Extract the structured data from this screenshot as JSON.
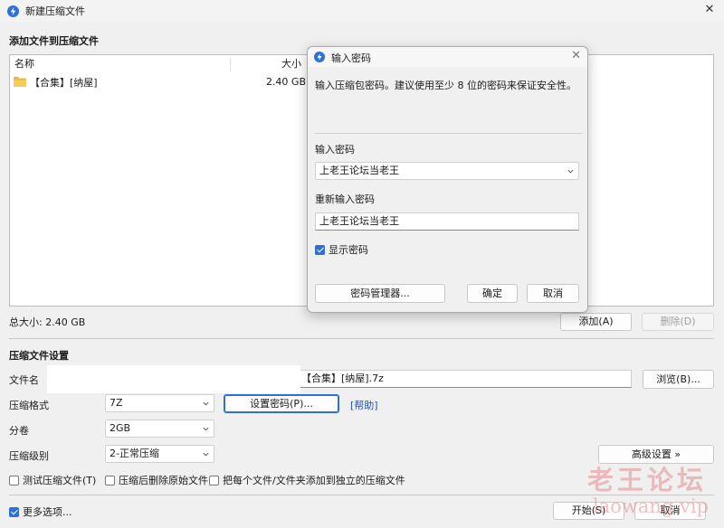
{
  "window": {
    "title": "新建压缩文件"
  },
  "add_section": {
    "title": "添加文件到压缩文件"
  },
  "file_list": {
    "columns": [
      "名称",
      "大小"
    ],
    "rows": [
      {
        "name": "【合集】[纳屋]",
        "size": "2.40 GB"
      }
    ]
  },
  "total_size": "总大小: 2.40 GB",
  "buttons": {
    "add": "添加(A)",
    "remove": "删除(D)",
    "browse": "浏览(B)...",
    "set_password": "设置密码(P)...",
    "advanced": "高级设置 »",
    "start": "开始(S)",
    "cancel": "取消"
  },
  "compress_settings": {
    "title": "压缩文件设置"
  },
  "fields": {
    "filename_label": "文件名",
    "filename_value": "【合集】[纳屋].7z",
    "format_label": "压缩格式",
    "format_value": "7Z",
    "help_link": "[帮助]",
    "volume_label": "分卷",
    "volume_value": "2GB",
    "level_label": "压缩级别",
    "level_value": "2-正常压缩"
  },
  "options": {
    "test": "测试压缩文件(T)",
    "delete_after": "压缩后删除原始文件",
    "separate": "把每个文件/文件夹添加到独立的压缩文件",
    "more": "更多选项..."
  },
  "password_dialog": {
    "title": "输入密码",
    "message": "输入压缩包密码。建议使用至少 8 位的密码来保证安全性。",
    "enter_label": "输入密码",
    "enter_value": "上老王论坛当老王",
    "reenter_label": "重新输入密码",
    "reenter_value": "上老王论坛当老王",
    "show_password": "显示密码",
    "manager_button": "密码管理器...",
    "ok_button": "确定",
    "cancel_button": "取消"
  },
  "watermark": {
    "cn": "老王论坛",
    "en": "laowang.vip"
  },
  "colors": {
    "accent": "#2f6fd8",
    "link": "#2150c8",
    "watermark": "#e1787d"
  }
}
